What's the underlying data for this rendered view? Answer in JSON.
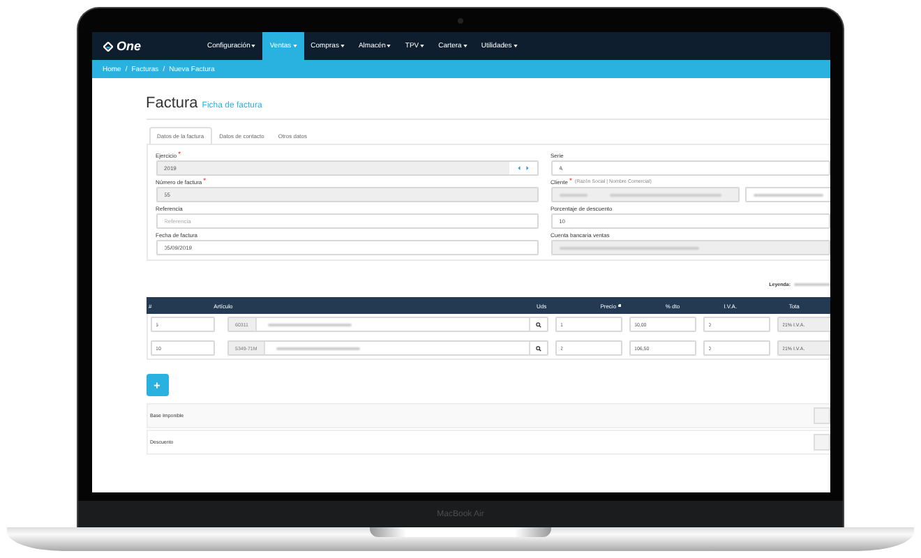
{
  "laptop": {
    "model": "MacBook Air"
  },
  "app": {
    "logo": "One"
  },
  "nav": [
    {
      "label": "Configuración",
      "selected": false
    },
    {
      "label": "Ventas",
      "selected": true
    },
    {
      "label": "Compras",
      "selected": false
    },
    {
      "label": "Almacén",
      "selected": false
    },
    {
      "label": "TPV",
      "selected": false
    },
    {
      "label": "Cartera",
      "selected": false
    },
    {
      "label": "Utilidades",
      "selected": false
    }
  ],
  "breadcrumb": [
    {
      "label": "Home"
    },
    {
      "separator": "/",
      "label": "Facturas"
    },
    {
      "separator": "/",
      "label": "Nueva Factura"
    }
  ],
  "page": {
    "title": "Factura",
    "subtitle": "Ficha de factura"
  },
  "tabs": [
    {
      "label": "Datos de la factura",
      "selected": true
    },
    {
      "label": "Datos de contacto",
      "selected": false
    },
    {
      "label": "Otros datos",
      "selected": false
    }
  ],
  "fields": [
    {
      "kind": "spinner",
      "label": "Ejercicio",
      "required_mark": "*",
      "value": "2019",
      "disabled": true
    },
    {
      "kind": "text",
      "label": "Serie",
      "value": "A",
      "disabled": false
    },
    {
      "kind": "text",
      "label": "Número de factura",
      "required_mark": "*",
      "value": "55",
      "disabled": true
    },
    {
      "kind": "client",
      "label": "Cliente",
      "required_mark": "*",
      "hint": "(Razón Social | Nombre Comercial)",
      "disabled": true
    },
    {
      "kind": "text",
      "label": "Referencia",
      "placeholder": "Referencia",
      "disabled": false
    },
    {
      "kind": "text",
      "label": "Porcentaje de descuento",
      "value": "10",
      "disabled": false
    },
    {
      "kind": "text",
      "label": "Fecha de factura",
      "value": "05/09/2019",
      "disabled": false
    },
    {
      "kind": "redacted",
      "label": "Cuenta bancaria ventas",
      "disabled": true
    }
  ],
  "legend": "Leyenda:",
  "table": {
    "columns": [
      "#",
      "Artículo",
      "Uds",
      "Precio",
      "% dto",
      "I.V.A.",
      "Tota"
    ],
    "rows": [
      {
        "num": "5",
        "code": "60311",
        "uds": "1",
        "precio": "60,00",
        "dto": "0",
        "iva": "21% I.V.A."
      },
      {
        "num": "10",
        "code": "5349-71M",
        "uds": "2",
        "precio": "106,50",
        "dto": "0",
        "iva": "21% I.V.A."
      }
    ]
  },
  "add_button": "+",
  "totals": [
    "Base Imponible",
    "Descuento"
  ]
}
